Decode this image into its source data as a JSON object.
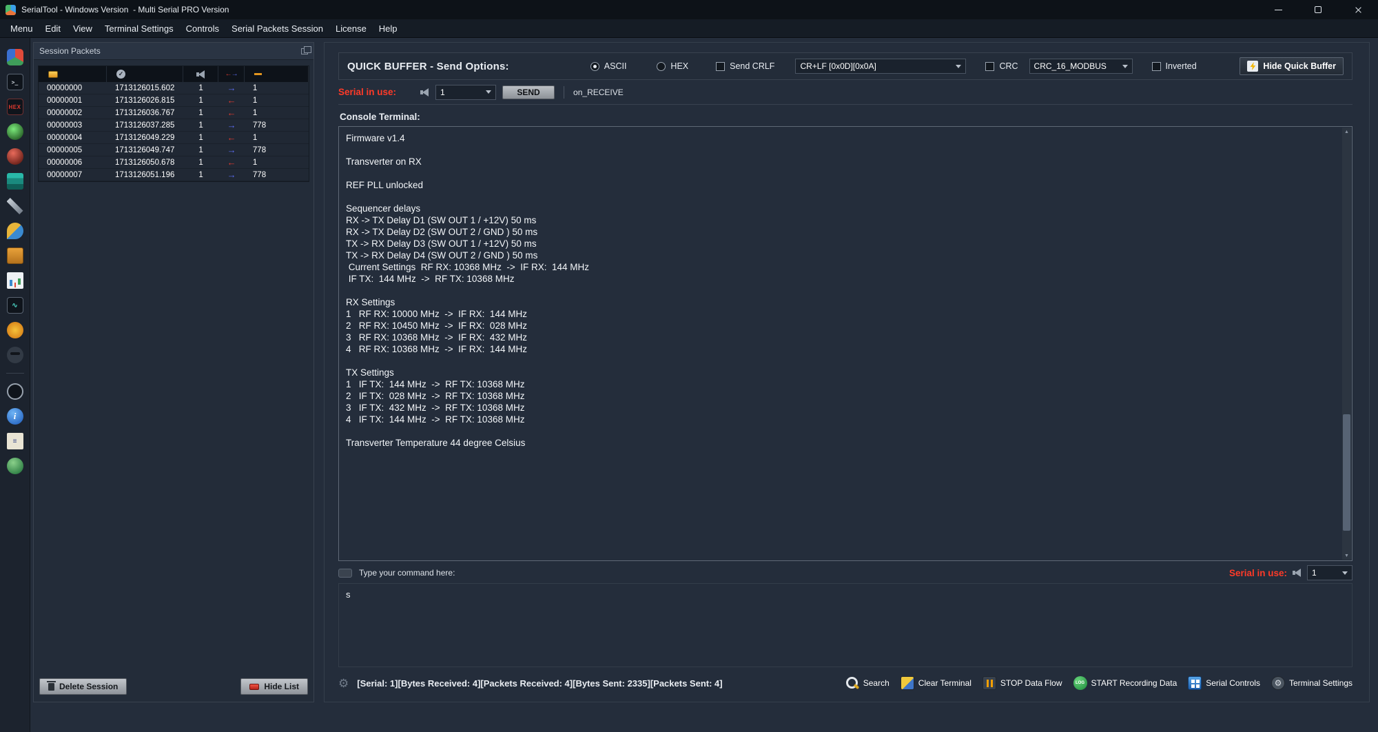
{
  "colors": {
    "accent-red": "#ff3a28",
    "arrow-right": "#5b6cf0",
    "arrow-left": "#e03a2f"
  },
  "window": {
    "app_title": "SerialTool - Windows Version  - Multi Serial PRO Version"
  },
  "menubar": {
    "items": [
      "Menu",
      "Edit",
      "View",
      "Terminal Settings",
      "Controls",
      "Serial Packets Session",
      "License",
      "Help"
    ]
  },
  "sidebar": {
    "icons": [
      "app-tools-icon",
      "terminal-panel-icon",
      "hex-icon",
      "matrix-icon",
      "sphere-icon",
      "layers-icon",
      "wrench-icon",
      "chat-icon",
      "clipboard-icon",
      "chart-icon",
      "graph-icon",
      "gear-burst-icon",
      "spy-icon",
      "divider",
      "compass-icon",
      "info-icon",
      "notes-icon",
      "globe-icon"
    ]
  },
  "session_panel": {
    "title": "Session Packets",
    "column_icons": [
      "packet-color-icon",
      "check-time-icon",
      "header-speaker-icon",
      "direction-arrows-icon",
      "dash-icon"
    ],
    "rows": [
      {
        "id": "00000000",
        "timestamp": "1713126015.602",
        "serial": "1",
        "direction": "right",
        "bytes": "1"
      },
      {
        "id": "00000001",
        "timestamp": "1713126026.815",
        "serial": "1",
        "direction": "left",
        "bytes": "1"
      },
      {
        "id": "00000002",
        "timestamp": "1713126036.767",
        "serial": "1",
        "direction": "left",
        "bytes": "1"
      },
      {
        "id": "00000003",
        "timestamp": "1713126037.285",
        "serial": "1",
        "direction": "right",
        "bytes": "778"
      },
      {
        "id": "00000004",
        "timestamp": "1713126049.229",
        "serial": "1",
        "direction": "left",
        "bytes": "1"
      },
      {
        "id": "00000005",
        "timestamp": "1713126049.747",
        "serial": "1",
        "direction": "right",
        "bytes": "778"
      },
      {
        "id": "00000006",
        "timestamp": "1713126050.678",
        "serial": "1",
        "direction": "left",
        "bytes": "1"
      },
      {
        "id": "00000007",
        "timestamp": "1713126051.196",
        "serial": "1",
        "direction": "right",
        "bytes": "778"
      }
    ],
    "delete_button": "Delete Session",
    "hide_button": "Hide List"
  },
  "quick_buffer": {
    "title": "QUICK BUFFER - Send Options:",
    "ascii_label": "ASCII",
    "hex_label": "HEX",
    "crlf_label": "Send CRLF",
    "crlf_value": "CR+LF [0x0D][0x0A]",
    "crc_label": "CRC",
    "crc_value": "CRC_16_MODBUS",
    "inverted_label": "Inverted",
    "hide_button": "Hide Quick Buffer",
    "serial_in_use_label": "Serial in use:",
    "serial_value": "1",
    "send_button": "SEND",
    "on_receive": "on_RECEIVE"
  },
  "terminal": {
    "label": "Console Terminal:",
    "lines": [
      "Firmware v1.4",
      "",
      "Transverter on RX",
      "",
      "REF PLL unlocked",
      "",
      "Sequencer delays",
      "RX -> TX Delay D1 (SW OUT 1 / +12V) 50 ms",
      "RX -> TX Delay D2 (SW OUT 2 / GND ) 50 ms",
      "TX -> RX Delay D3 (SW OUT 1 / +12V) 50 ms",
      "TX -> RX Delay D4 (SW OUT 2 / GND ) 50 ms",
      " Current Settings  RF RX: 10368 MHz  ->  IF RX:  144 MHz",
      " IF TX:  144 MHz  ->  RF TX: 10368 MHz",
      "",
      "RX Settings",
      "1   RF RX: 10000 MHz  ->  IF RX:  144 MHz",
      "2   RF RX: 10450 MHz  ->  IF RX:  028 MHz",
      "3   RF RX: 10368 MHz  ->  IF RX:  432 MHz",
      "4   RF RX: 10368 MHz  ->  IF RX:  144 MHz",
      "",
      "TX Settings",
      "1   IF TX:  144 MHz  ->  RF TX: 10368 MHz",
      "2   IF TX:  028 MHz  ->  RF TX: 10368 MHz",
      "3   IF TX:  432 MHz  ->  RF TX: 10368 MHz",
      "4   IF TX:  144 MHz  ->  RF TX: 10368 MHz",
      "",
      "Transverter Temperature 44 degree Celsius"
    ]
  },
  "command": {
    "prompt": "Type your command here:",
    "serial_in_use_label": "Serial in use:",
    "serial_value": "1",
    "value": "s"
  },
  "statusbar": {
    "status": "[Serial: 1][Bytes Received: 4][Packets Received: 4][Bytes Sent: 2335][Packets Sent: 4]",
    "buttons": [
      {
        "label": "Search",
        "icon": "search-icon"
      },
      {
        "label": "Clear Terminal",
        "icon": "clear-terminal-icon"
      },
      {
        "label": "STOP Data Flow",
        "icon": "stop-data-flow-icon"
      },
      {
        "label": "START Recording Data",
        "icon": "start-recording-icon"
      },
      {
        "label": "Serial Controls",
        "icon": "serial-controls-icon"
      },
      {
        "label": "Terminal Settings",
        "icon": "terminal-settings-icon"
      }
    ]
  }
}
